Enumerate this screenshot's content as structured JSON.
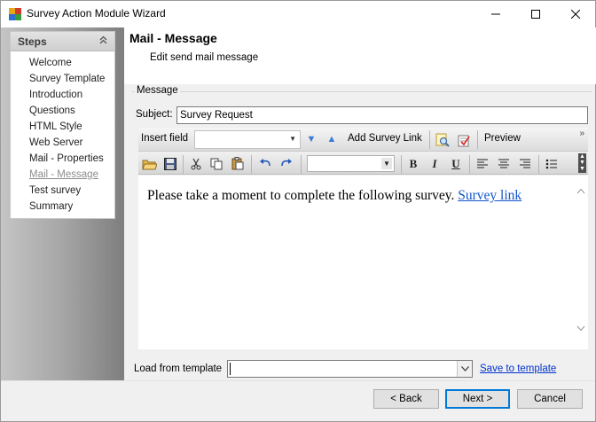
{
  "window": {
    "title": "Survey Action Module Wizard",
    "controls": {
      "minimize": "—",
      "maximize": "☐",
      "close": "✕"
    }
  },
  "sidebar": {
    "header": "Steps",
    "steps": [
      {
        "label": "Welcome"
      },
      {
        "label": "Survey Template"
      },
      {
        "label": "Introduction"
      },
      {
        "label": "Questions"
      },
      {
        "label": "HTML Style"
      },
      {
        "label": "Web Server"
      },
      {
        "label": "Mail - Properties"
      },
      {
        "label": "Mail - Message",
        "active": true
      },
      {
        "label": "Test survey"
      },
      {
        "label": "Summary"
      }
    ]
  },
  "page": {
    "title": "Mail - Message",
    "subtitle": "Edit send mail message"
  },
  "message_group": {
    "title": "Message",
    "subject_label": "Subject:",
    "subject_value": "Survey Request"
  },
  "toolbar": {
    "insert_field_label": "Insert field",
    "insert_field_value": "",
    "add_survey_link": "Add Survey Link",
    "preview": "Preview",
    "overflow": "»",
    "font_value": "",
    "bold": "B",
    "italic": "I",
    "underline": "U"
  },
  "editor": {
    "body_text": "Please take a moment to complete the following survey.",
    "link_text": "Survey link"
  },
  "template": {
    "load_label": "Load from template",
    "load_value": "",
    "save_link": "Save to template"
  },
  "buttons": {
    "back": "< Back",
    "next": "Next >",
    "cancel": "Cancel"
  }
}
